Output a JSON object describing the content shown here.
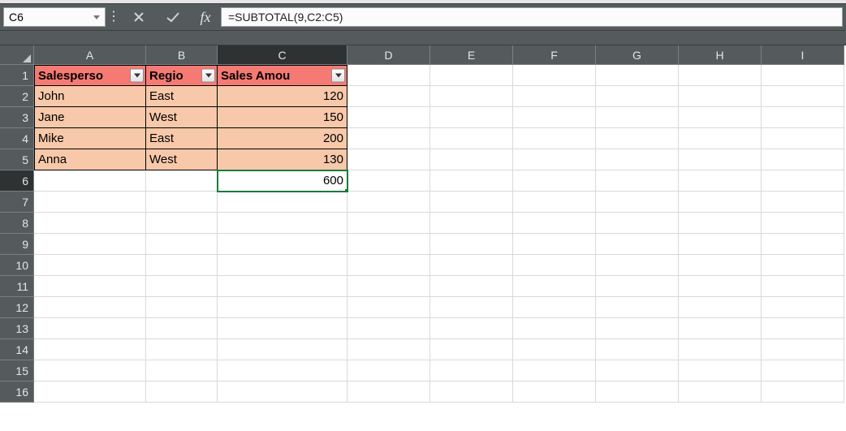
{
  "name_box": "C6",
  "formula": "=SUBTOTAL(9,C2:C5)",
  "columns": [
    "A",
    "B",
    "C",
    "D",
    "E",
    "F",
    "G",
    "H",
    "I"
  ],
  "active_col_index": 2,
  "row_count": 16,
  "active_row_index": 5,
  "col_widths": {
    "A": 138,
    "B": 88,
    "C": 160,
    "rest": 102
  },
  "table": {
    "headers": [
      "Salesperson",
      "Region",
      "Sales Amount"
    ],
    "header_display": [
      "Salesperso",
      "Regio",
      "Sales Amou"
    ],
    "rows": [
      {
        "salesperson": "John",
        "region": "East",
        "sales": 120
      },
      {
        "salesperson": "Jane",
        "region": "West",
        "sales": 150
      },
      {
        "salesperson": "Mike",
        "region": "East",
        "sales": 200
      },
      {
        "salesperson": "Anna",
        "region": "West",
        "sales": 130
      }
    ],
    "subtotal": 600
  },
  "colors": {
    "header_bg": "#f57a74",
    "data_bg": "#f7c8a9",
    "selection": "#1a7b3c",
    "grid_chrome": "#555a5c"
  },
  "chart_data": {
    "type": "table",
    "title": "",
    "columns": [
      "Salesperson",
      "Region",
      "Sales Amount"
    ],
    "rows": [
      [
        "John",
        "East",
        120
      ],
      [
        "Jane",
        "West",
        150
      ],
      [
        "Mike",
        "East",
        200
      ],
      [
        "Anna",
        "West",
        130
      ]
    ],
    "subtotal_row": [
      "",
      "",
      600
    ],
    "subtotal_formula": "=SUBTOTAL(9,C2:C5)"
  }
}
